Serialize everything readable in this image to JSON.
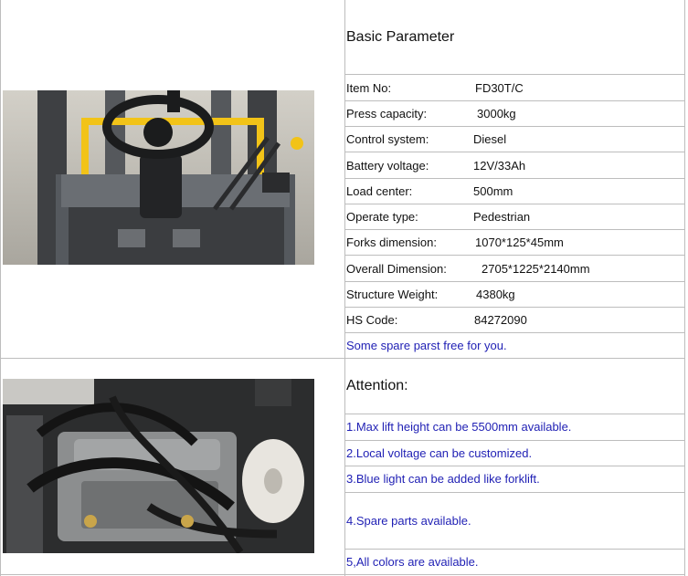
{
  "basic": {
    "heading": "Basic Parameter",
    "rows": [
      {
        "label": "Item No:",
        "value": "FD30T/C"
      },
      {
        "label": "Press capacity:",
        "value": "3000kg"
      },
      {
        "label": "Control system:",
        "value": "Diesel"
      },
      {
        "label": "Battery voltage:",
        "value": "12V/33Ah"
      },
      {
        "label": "Load center:",
        "value": "500mm"
      },
      {
        "label": "Operate type:",
        "value": "Pedestrian"
      },
      {
        "label": "Forks dimension:",
        "value": "1070*125*45mm"
      },
      {
        "label": "Overall Dimension:",
        "value": "2705*1225*2140mm"
      },
      {
        "label": "Structure Weight:",
        "value": "4380kg"
      },
      {
        "label": "HS Code:",
        "value": "84272090"
      }
    ],
    "note": "Some spare parst free for you."
  },
  "attention": {
    "heading": "Attention:",
    "items": [
      "1.Max lift height can be 5500mm available.",
      "2.Local voltage can be customized.",
      "3.Blue light can be added like forklift.",
      "4.Spare parts available.",
      "5,All colors are available."
    ]
  },
  "colors": {
    "blue_text": "#1f1fb4",
    "grid_line": "#bdbdbd",
    "forklift_yellow": "#f2c318"
  }
}
